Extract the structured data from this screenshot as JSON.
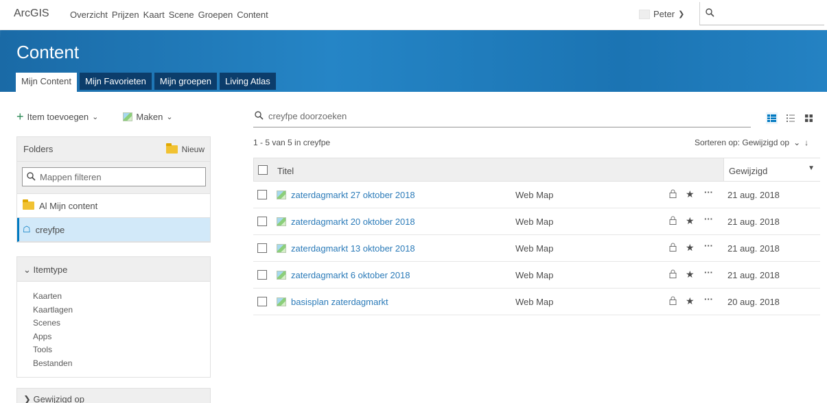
{
  "topnav": {
    "brand": "ArcGIS",
    "links": [
      "Overzicht",
      "Prijzen",
      "Kaart",
      "Scene",
      "Groepen",
      "Content"
    ],
    "active_link": "Content",
    "user": "Peter"
  },
  "banner": {
    "title": "Content",
    "tabs": [
      "Mijn Content",
      "Mijn Favorieten",
      "Mijn groepen",
      "Living Atlas"
    ],
    "active_tab": "Mijn Content"
  },
  "actions": {
    "add_item": "Item toevoegen",
    "create": "Maken"
  },
  "folders": {
    "title": "Folders",
    "new_label": "Nieuw",
    "filter_placeholder": "Mappen filteren",
    "items": [
      {
        "label": "Al Mijn content",
        "selected": false
      },
      {
        "label": "creyfpe",
        "selected": true
      }
    ]
  },
  "itemtype": {
    "title": "Itemtype",
    "options": [
      "Kaarten",
      "Kaartlagen",
      "Scenes",
      "Apps",
      "Tools",
      "Bestanden"
    ]
  },
  "modified_filter": {
    "title": "Gewijzigd op"
  },
  "main": {
    "search_placeholder": "creyfpe doorzoeken",
    "count_text": "1 - 5 van 5 in creyfpe",
    "sort_label": "Sorteren op: Gewijzigd op",
    "columns": {
      "title": "Titel",
      "modified": "Gewijzigd"
    },
    "rows": [
      {
        "title": "zaterdagmarkt 27 oktober 2018",
        "type": "Web Map",
        "modified": "21 aug. 2018"
      },
      {
        "title": "zaterdagmarkt 20 oktober 2018",
        "type": "Web Map",
        "modified": "21 aug. 2018"
      },
      {
        "title": "zaterdagmarkt 13 oktober 2018",
        "type": "Web Map",
        "modified": "21 aug. 2018"
      },
      {
        "title": "zaterdagmarkt 6 oktober 2018",
        "type": "Web Map",
        "modified": "21 aug. 2018"
      },
      {
        "title": "basisplan zaterdagmarkt",
        "type": "Web Map",
        "modified": "20 aug. 2018"
      }
    ]
  },
  "colors": {
    "accent": "#0079c1",
    "banner": "#1f79b8",
    "tab_dark": "#0c3d6b",
    "link": "#2a7ab8",
    "selected_bg": "#d2e9f9"
  }
}
